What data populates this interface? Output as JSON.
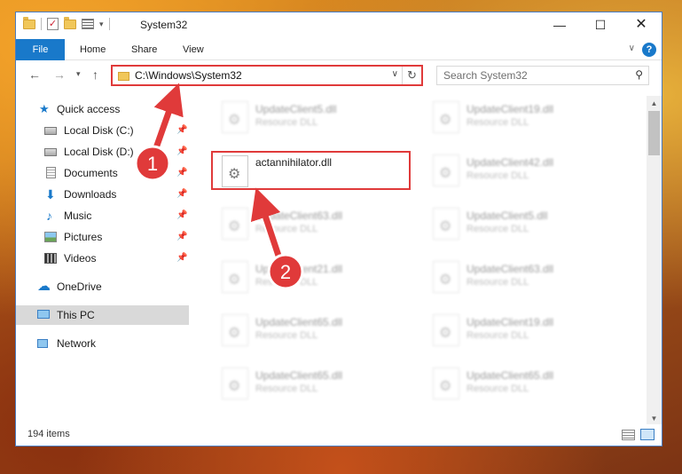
{
  "window": {
    "title": "System32",
    "controls": {
      "minimize": "—",
      "maximize": "☐",
      "close": "✕"
    }
  },
  "ribbon": {
    "tabs": [
      {
        "label": "File"
      },
      {
        "label": "Home"
      },
      {
        "label": "Share"
      },
      {
        "label": "View"
      }
    ],
    "help": "?"
  },
  "address": {
    "path": "C:\\Windows\\System32",
    "search_placeholder": "Search System32"
  },
  "sidebar": {
    "items": [
      {
        "label": "Quick access"
      },
      {
        "label": "Local Disk (C:)"
      },
      {
        "label": "Local Disk (D:)"
      },
      {
        "label": "Documents"
      },
      {
        "label": "Downloads"
      },
      {
        "label": "Music"
      },
      {
        "label": "Pictures"
      },
      {
        "label": "Videos"
      },
      {
        "label": "OneDrive"
      },
      {
        "label": "This PC"
      },
      {
        "label": "Network"
      }
    ]
  },
  "files": {
    "left": [
      {
        "name": "UpdateClient5.dll",
        "type": "Resource DLL"
      },
      {
        "name": "actannihilator.dll",
        "type": ""
      },
      {
        "name": "UpdateClient63.dll",
        "type": "Resource DLL"
      },
      {
        "name": "UpdateClient21.dll",
        "type": "Resource DLL"
      },
      {
        "name": "UpdateClient65.dll",
        "type": "Resource DLL"
      },
      {
        "name": "UpdateClient65.dll",
        "type": "Resource DLL"
      }
    ],
    "right": [
      {
        "name": "UpdateClient19.dll",
        "type": "Resource DLL"
      },
      {
        "name": "UpdateClient42.dll",
        "type": "Resource DLL"
      },
      {
        "name": "UpdateClient5.dll",
        "type": "Resource DLL"
      },
      {
        "name": "UpdateClient63.dll",
        "type": "Resource DLL"
      },
      {
        "name": "UpdateClient19.dll",
        "type": "Resource DLL"
      },
      {
        "name": "UpdateClient65.dll",
        "type": "Resource DLL"
      }
    ]
  },
  "status": {
    "item_count": "194 items"
  },
  "annotations": {
    "step1": "1",
    "step2": "2",
    "accent": "#e03a3a"
  }
}
